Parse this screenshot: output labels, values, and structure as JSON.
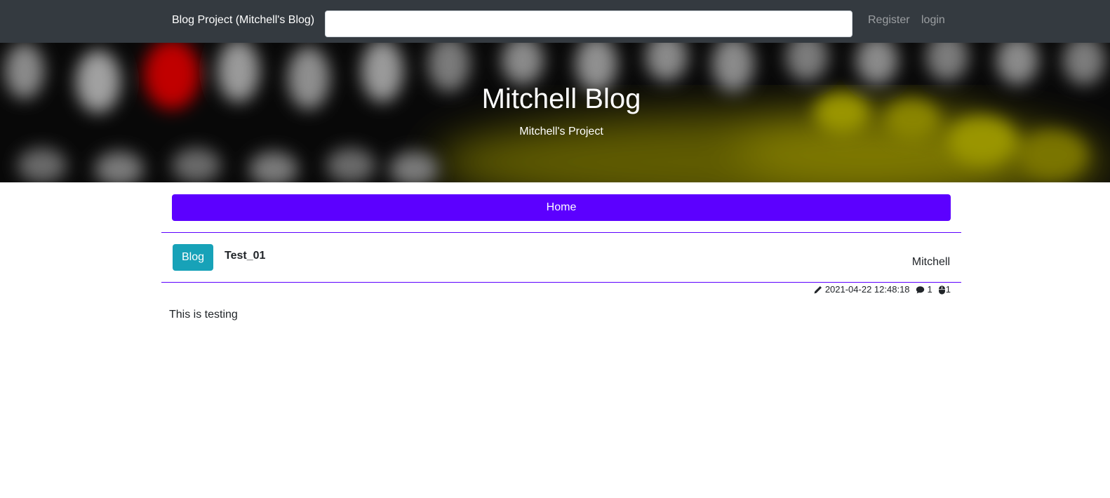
{
  "navbar": {
    "brand": "Blog Project (Mitchell's Blog)",
    "search_value": "",
    "register_label": "Register",
    "login_label": "login"
  },
  "hero": {
    "title": "Mitchell Blog",
    "subtitle": "Mitchell's Project"
  },
  "menu": {
    "home_label": "Home"
  },
  "post": {
    "category": "Blog",
    "title": "Test_01",
    "author": "Mitchell",
    "date": "2021-04-22 12:48:18",
    "comment_count": "1",
    "view_count": "1",
    "body": "This is testing"
  },
  "colors": {
    "navbar_bg": "#343a40",
    "accent": "#5c00ff",
    "badge": "#17a2b8"
  },
  "icons": {
    "date": "pencil-icon",
    "comments": "comment-icon",
    "views": "mouse-icon"
  }
}
